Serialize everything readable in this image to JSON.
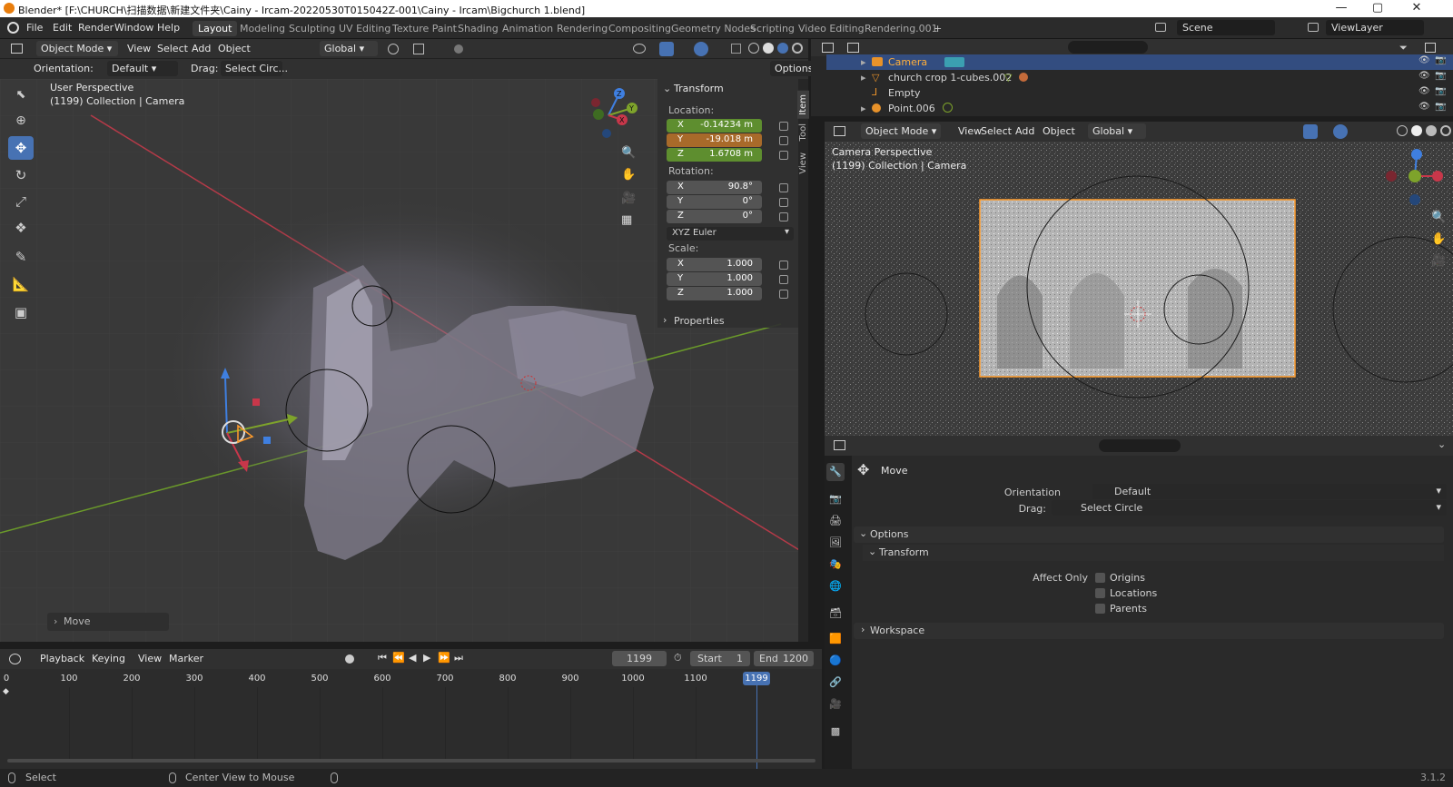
{
  "window": {
    "title": "Blender* [F:\\CHURCH\\扫描数据\\新建文件夹\\Cainy - Ircam-20220530T015042Z-001\\Cainy - Ircam\\Bigchurch 1.blend]",
    "min": "—",
    "max": "▢",
    "close": "✕"
  },
  "menu": {
    "items": [
      "File",
      "Edit",
      "Render",
      "Window",
      "Help"
    ],
    "workspaces": [
      "Layout",
      "Modeling",
      "Sculpting",
      "UV Editing",
      "Texture Paint",
      "Shading",
      "Animation",
      "Rendering",
      "Compositing",
      "Geometry Nodes",
      "Scripting",
      "Video Editing",
      "Rendering.001"
    ],
    "add_tab": "+",
    "scene_label": "Scene",
    "viewlayer_label": "ViewLayer"
  },
  "viewport": {
    "mode": "Object Mode",
    "menus": [
      "View",
      "Select",
      "Add",
      "Object"
    ],
    "transform_orientation": "Global",
    "orientation_label": "Orientation:",
    "orientation_value": "Default",
    "drag_label": "Drag:",
    "drag_value": "Select Circ...",
    "options_label": "Options",
    "overlay_title": "User Perspective",
    "overlay_sub": "(1199) Collection | Camera",
    "last_op_label": "Move",
    "gizmo_axes": [
      "X",
      "Y",
      "Z"
    ]
  },
  "npanel": {
    "tabs": [
      "Item",
      "Tool",
      "View"
    ],
    "transform_label": "Transform",
    "location_label": "Location:",
    "location": [
      {
        "axis": "X",
        "value": "-0.14234 m"
      },
      {
        "axis": "Y",
        "value": "-19.018 m"
      },
      {
        "axis": "Z",
        "value": "1.6708 m"
      }
    ],
    "rotation_label": "Rotation:",
    "rotation": [
      {
        "axis": "X",
        "value": "90.8°"
      },
      {
        "axis": "Y",
        "value": "0°"
      },
      {
        "axis": "Z",
        "value": "0°"
      }
    ],
    "rotation_mode": "XYZ Euler",
    "scale_label": "Scale:",
    "scale": [
      {
        "axis": "X",
        "value": "1.000"
      },
      {
        "axis": "Y",
        "value": "1.000"
      },
      {
        "axis": "Z",
        "value": "1.000"
      }
    ],
    "properties_label": "Properties"
  },
  "outliner": {
    "rows": [
      {
        "name": "Camera",
        "selected": true
      },
      {
        "name": "church crop 1-cubes.002",
        "selected": false
      },
      {
        "name": "Empty",
        "selected": false
      },
      {
        "name": "Point.006",
        "selected": false
      }
    ]
  },
  "camera_view": {
    "mode": "Object Mode",
    "menus": [
      "View",
      "Select",
      "Add",
      "Object"
    ],
    "transform_orientation": "Global",
    "overlay_title": "Camera Perspective",
    "overlay_sub": "(1199) Collection | Camera"
  },
  "properties": {
    "tool_name": "Move",
    "orientation_label": "Orientation",
    "orientation_value": "Default",
    "drag_label": "Drag:",
    "drag_value": "Select Circle",
    "options_label": "Options",
    "transform_label": "Transform",
    "affect_only_label": "Affect Only",
    "checks": [
      "Origins",
      "Locations",
      "Parents"
    ],
    "workspace_label": "Workspace"
  },
  "timeline": {
    "menus": [
      "Playback",
      "Keying",
      "View",
      "Marker"
    ],
    "current_frame": "1199",
    "start_label": "Start",
    "start_value": "1",
    "end_label": "End",
    "end_value": "1200",
    "ticks": [
      "0",
      "100",
      "200",
      "300",
      "400",
      "500",
      "600",
      "700",
      "800",
      "900",
      "1000",
      "1100"
    ],
    "playhead_label": "1199"
  },
  "statusbar": {
    "select": "Select",
    "center_view": "Center View to Mouse",
    "version": "3.1.2"
  },
  "colors": {
    "accent": "#4772b3",
    "x_axis": "#c8374a",
    "y_axis": "#7ea32b",
    "z_axis": "#3f7fe0",
    "selection": "#ff9c2c"
  }
}
